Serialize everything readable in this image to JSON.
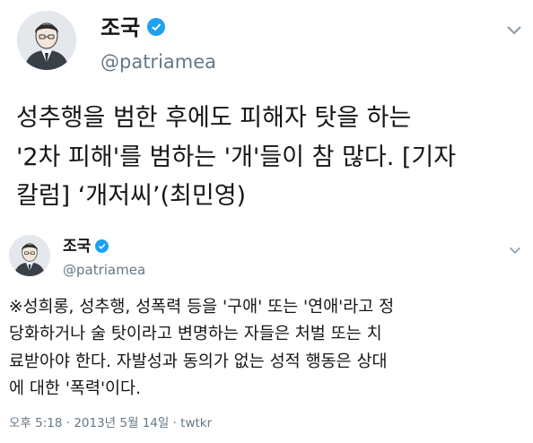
{
  "outer_tweet": {
    "author_name": "조국",
    "author_handle": "@patriamea",
    "lines": [
      "성추행을 범한 후에도 피해자 탓을 하는",
      "'2차 피해'를 범하는 '개'들이 참 많다. [기자",
      "칼럼] ‘개저씨’(최민영)"
    ]
  },
  "quoted_tweet": {
    "author_name": "조국",
    "author_handle": "@patriamea",
    "lines": [
      "※성희롱, 성추행, 성폭력 등을 '구애' 또는 '연애'라고 정",
      "당화하거나 술 탓이라고 변명하는 자들은 처벌 또는 치",
      "료받아야 한다. 자발성과 동의가 없는 성적 행동은 상대",
      "에 대한 '폭력'이다."
    ],
    "timestamp": "오후 5:18 · 2013년 5월 14일 · twtkr"
  },
  "icons": {
    "verified": "verified-badge-icon",
    "menu": "chevron-down-icon",
    "avatar": "avatar-icon"
  },
  "colors": {
    "verified": "#1da1f2",
    "text": "#14171a",
    "muted": "#657786"
  }
}
